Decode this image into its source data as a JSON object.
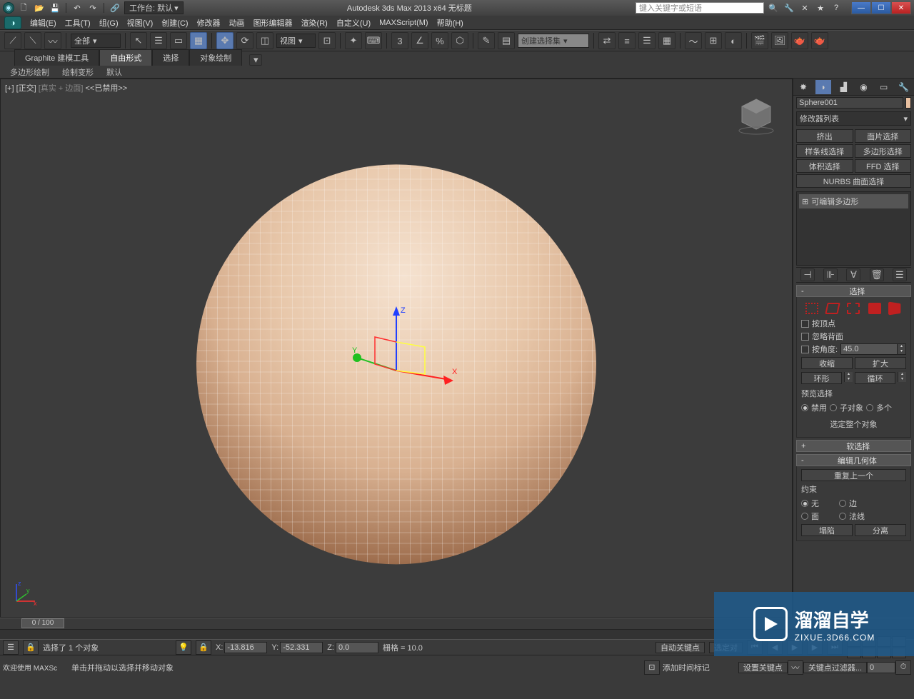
{
  "titlebar": {
    "workspace_label": "工作台: 默认",
    "app_title": "Autodesk 3ds Max  2013 x64     无标题",
    "search_placeholder": "键入关键字或短语"
  },
  "menu": {
    "edit": "编辑(E)",
    "tools": "工具(T)",
    "group": "组(G)",
    "views": "视图(V)",
    "create": "创建(C)",
    "modifiers": "修改器",
    "animation": "动画",
    "graph_editors": "图形编辑器",
    "rendering": "渲染(R)",
    "customize": "自定义(U)",
    "maxscript": "MAXScript(M)",
    "help": "帮助(H)"
  },
  "toolbar": {
    "filter_all": "全部",
    "view_ref": "视图",
    "sel_set_placeholder": "创建选择集"
  },
  "ribbon": {
    "tab1": "Graphite 建模工具",
    "tab2": "自由形式",
    "tab3": "选择",
    "tab4": "对象绘制",
    "sub1": "多边形绘制",
    "sub2": "绘制变形",
    "sub3": "默认"
  },
  "viewport": {
    "label_prefix": "[+] [正交] ",
    "label_shaded": "[真实 + 边面]",
    "label_suffix": "  <<已禁用>>"
  },
  "panel": {
    "object_name": "Sphere001",
    "modifier_list": "修改器列表",
    "btn_extrude": "挤出",
    "btn_face_sel": "面片选择",
    "btn_spline_sel": "样条线选择",
    "btn_poly_sel": "多边形选择",
    "btn_vol_sel": "体积选择",
    "btn_ffd_sel": "FFD 选择",
    "btn_nurbs": "NURBS 曲面选择",
    "stack_item": "可编辑多边形",
    "rollout_sel": "选择",
    "chk_byvertex": "按顶点",
    "chk_ignoreback": "忽略背面",
    "chk_byangle": "按角度:",
    "angle_value": "45.0",
    "btn_shrink": "收缩",
    "btn_grow": "扩大",
    "btn_ring": "环形",
    "btn_loop": "循环",
    "preview_sel": "预览选择",
    "radio_off": "禁用",
    "radio_subobj": "子对象",
    "radio_multi": "多个",
    "sel_whole": "选定整个对象",
    "rollout_soft": "软选择",
    "rollout_editgeom": "编辑几何体",
    "btn_repeat": "重复上一个",
    "constraint": "约束",
    "c_none": "无",
    "c_edge": "边",
    "c_face": "面",
    "c_normal": "法线",
    "btn_collapse": "塌陷",
    "btn_detach": "分离"
  },
  "timeline": {
    "slider": "0 / 100"
  },
  "status": {
    "selected": "选择了 1 个对象",
    "prompt": "单击并拖动以选择并移动对象",
    "x_label": "X:",
    "x_val": "-13.816",
    "y_label": "Y:",
    "y_val": "-52.331",
    "z_label": "Z:",
    "z_val": "0.0",
    "grid": "栅格 = 10.0",
    "auto_key": "自动关键点",
    "set_key": "设置关键点",
    "sel_set": "选定对",
    "key_filter": "关键点过滤器...",
    "add_time_tag": "添加时间标记",
    "welcome": "欢迎使用 MAXSc"
  },
  "watermark": {
    "big": "溜溜自学",
    "small": "ZIXUE.3D66.COM"
  }
}
